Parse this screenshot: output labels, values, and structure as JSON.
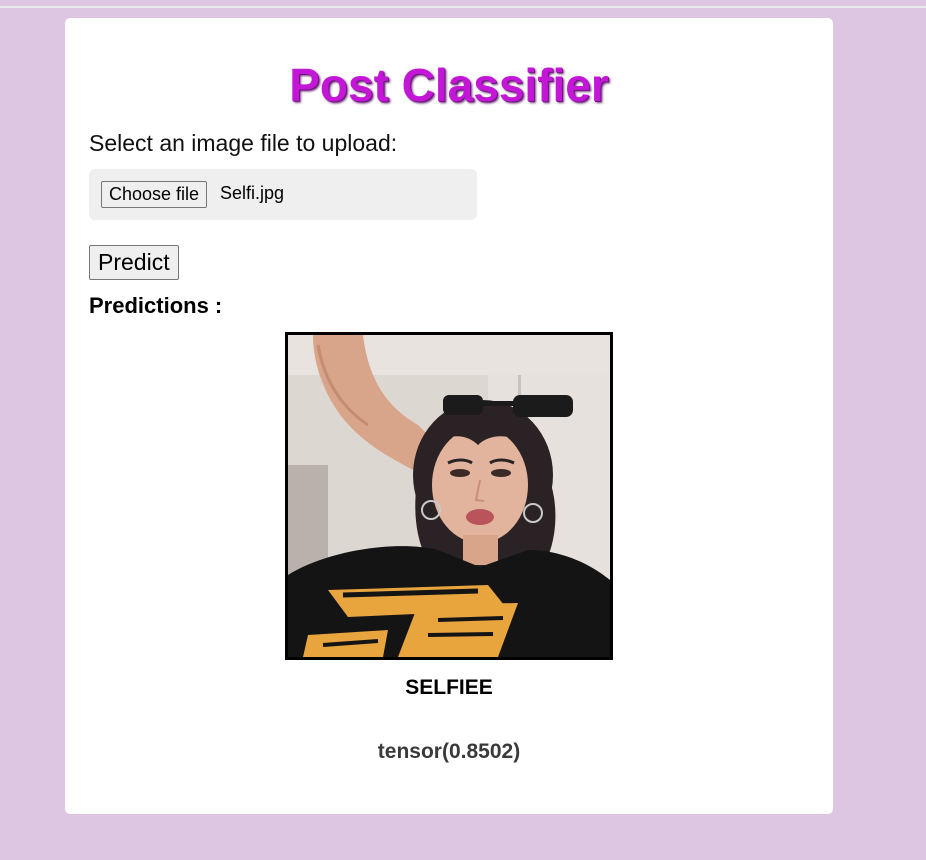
{
  "app": {
    "title": "Post Classifier"
  },
  "upload": {
    "label": "Select an image file to upload:",
    "choose_button": "Choose file",
    "file_name": "Selfi.jpg"
  },
  "actions": {
    "predict_label": "Predict"
  },
  "predictions": {
    "heading": "Predictions :",
    "image_icon": "uploaded-photo",
    "class_label": "SELFIEE",
    "score": "tensor(0.8502)"
  },
  "colors": {
    "page_background": "#dcc6e2",
    "card_background": "#ffffff",
    "title_color": "#c316d7"
  }
}
